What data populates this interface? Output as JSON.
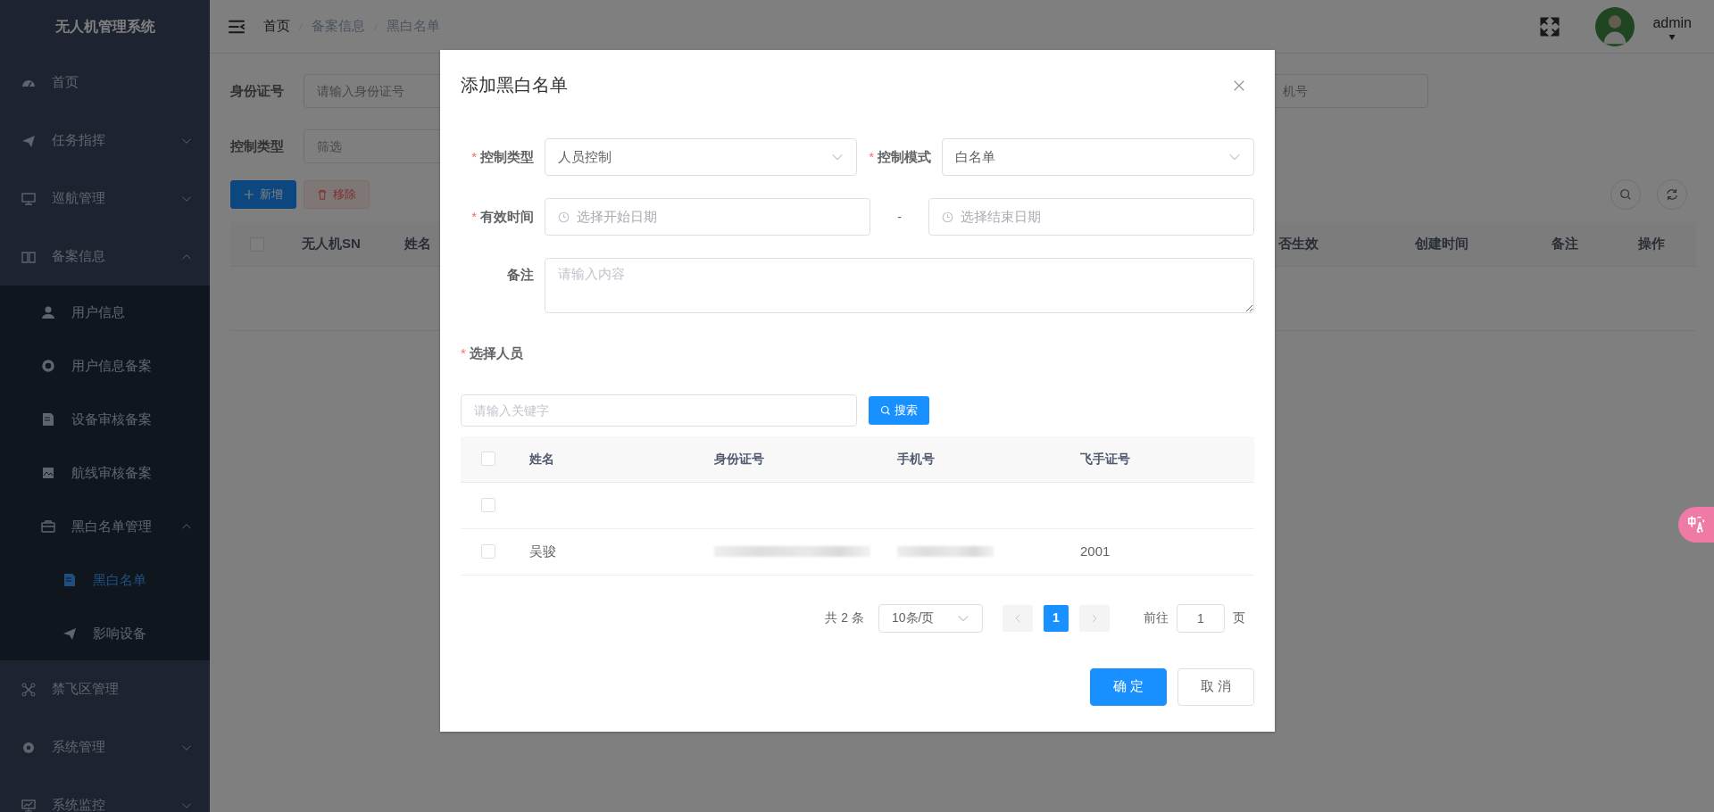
{
  "sidebar": {
    "title": "无人机管理系统",
    "items": [
      {
        "label": "首页",
        "selected": false
      },
      {
        "label": "任务指挥",
        "expanded": false,
        "selected": false
      },
      {
        "label": "巡航管理",
        "expanded": false,
        "selected": false
      },
      {
        "label": "备案信息",
        "expanded": true,
        "selected": false,
        "children": [
          {
            "label": "用户信息",
            "selected": false
          },
          {
            "label": "用户信息备案",
            "selected": false
          },
          {
            "label": "设备审核备案",
            "selected": false
          },
          {
            "label": "航线审核备案",
            "selected": false
          },
          {
            "label": "黑白名单管理",
            "expanded": true,
            "selected": false,
            "children": [
              {
                "label": "黑白名单",
                "selected": true
              },
              {
                "label": "影响设备",
                "selected": false
              }
            ]
          }
        ]
      },
      {
        "label": "禁飞区管理",
        "selected": false
      },
      {
        "label": "系统管理",
        "expanded": false,
        "selected": false
      },
      {
        "label": "系统监控",
        "expanded": false,
        "selected": false
      }
    ]
  },
  "header": {
    "breadcrumb": [
      "首页",
      "备案信息",
      "黑白名单"
    ],
    "user": "admin"
  },
  "filters": [
    {
      "label": "身份证号",
      "placeholder": "请输入身份证号"
    },
    {
      "label": "控制类型",
      "placeholder": "筛选"
    },
    {
      "placeholder": "机号"
    }
  ],
  "actions": [
    {
      "label": "新增",
      "kind": "add"
    },
    {
      "label": "移除",
      "kind": "remove"
    }
  ],
  "table": {
    "select_all_checked": false,
    "columns": [
      "无人机SN",
      "姓名",
      "否生效",
      "创建时间",
      "备注",
      "操作"
    ]
  },
  "dialog": {
    "title": "添加黑白名单",
    "control_type": {
      "label": "控制类型",
      "value": "人员控制",
      "required_mark": "*"
    },
    "control_mode": {
      "label": "控制模式",
      "value": "白名单",
      "required_mark": "*"
    },
    "valid_time": {
      "label": "有效时间",
      "required_mark": "*",
      "start_placeholder": "选择开始日期",
      "separator": "-",
      "end_placeholder": "选择结束日期"
    },
    "remark": {
      "label": "备注",
      "placeholder": "请输入内容"
    },
    "people": {
      "label": "选择人员",
      "required_mark": "*",
      "search_placeholder": "请输入关键字",
      "search_button": "搜索",
      "select_all_checked": false,
      "columns": [
        "姓名",
        "身份证号",
        "手机号",
        "飞手证号"
      ],
      "rows": [
        {
          "checked": false,
          "name": "",
          "id_redacted": false,
          "phone_redacted": false,
          "pilot_no": ""
        },
        {
          "checked": false,
          "name": "吴骏",
          "id_redacted": true,
          "phone_redacted": true,
          "pilot_no": "2001"
        }
      ],
      "pagination": {
        "total": "共 2 条",
        "page_size": "10条/页",
        "pages": [
          {
            "label": "1",
            "selected": true
          }
        ],
        "goto_label": "前往",
        "goto_value": "1",
        "page_unit": "页"
      }
    },
    "buttons": [
      {
        "label": "确 定",
        "kind": "primary"
      },
      {
        "label": "取 消",
        "kind": "default"
      }
    ]
  }
}
